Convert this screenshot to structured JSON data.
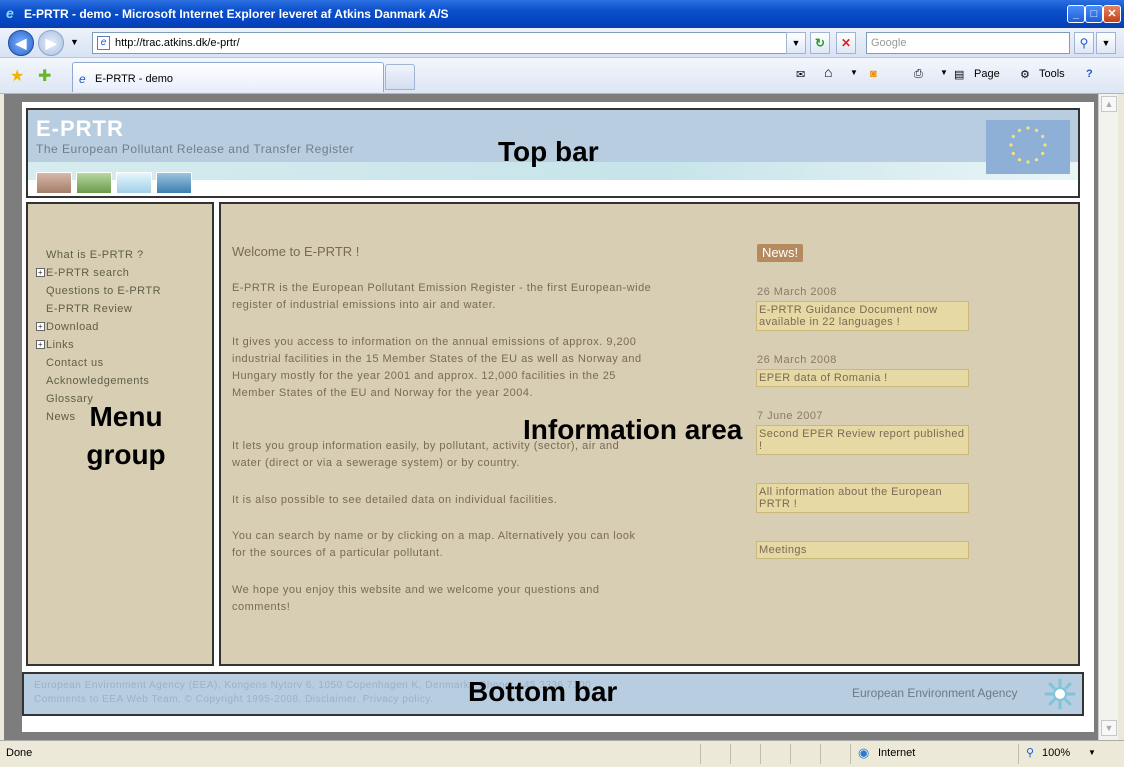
{
  "window": {
    "title": "E-PRTR - demo - Microsoft Internet Explorer leveret af Atkins Danmark A/S",
    "minimize": "_",
    "maximize": "□",
    "close": "✕"
  },
  "browser": {
    "address": "http://trac.atkins.dk/e-prtr/",
    "search_placeholder": "Google",
    "tab_title": "E-PRTR - demo",
    "tools": {
      "page_label": "Page",
      "tools_label": "Tools"
    }
  },
  "site": {
    "title": "E-PRTR",
    "subtitle": "The European Pollutant Release and Transfer Register"
  },
  "annotations": {
    "top_bar": "Top bar",
    "menu_group": "Menu group",
    "information_area": "Information area",
    "bottom_bar": "Bottom bar"
  },
  "menu": {
    "items": [
      {
        "label": "What is E-PRTR ?",
        "expandable": false
      },
      {
        "label": "E-PRTR search",
        "expandable": true
      },
      {
        "label": "Questions to E-PRTR",
        "expandable": false
      },
      {
        "label": "E-PRTR Review",
        "expandable": false
      },
      {
        "label": "Download",
        "expandable": true
      },
      {
        "label": "Links",
        "expandable": true
      },
      {
        "label": "Contact us",
        "expandable": false
      },
      {
        "label": "Acknowledgements",
        "expandable": false
      },
      {
        "label": "Glossary",
        "expandable": false
      },
      {
        "label": "News",
        "expandable": false
      }
    ]
  },
  "info": {
    "welcome": "Welcome to E-PRTR !",
    "paragraphs": [
      "E-PRTR is the European Pollutant Emission Register - the first European-wide register of industrial emissions into air and water.",
      "It gives you access to information on the annual emissions of approx. 9,200 industrial facilities in the 15 Member States of the EU as well as Norway and Hungary mostly for the year 2001 and approx. 12,000 facilities in the 25 Member States of the EU and Norway for the year 2004.",
      "It lets you group information easily, by pollutant, activity (sector), air and water (direct or via a sewerage system) or by country.",
      "It is also possible to see detailed data on individual facilities.",
      "You can search by name or by clicking on a map. Alternatively you can look for the sources of a particular pollutant.",
      "We hope you enjoy this website and we welcome your questions and comments!"
    ]
  },
  "news": {
    "badge": "News!",
    "items": [
      {
        "date": "26 March 2008",
        "text": "E-PRTR Guidance Document now available in 22 languages !"
      },
      {
        "date": "26 March 2008",
        "text": "EPER data of Romania !"
      },
      {
        "date": "7 June 2007",
        "text": "Second EPER Review report published !"
      },
      {
        "date": "",
        "text": "All information about the European PRTR !"
      },
      {
        "date": "",
        "text": "Meetings"
      }
    ]
  },
  "footer": {
    "line1": "European Environment Agency (EEA), Kongens Nytorv 6, 1050 Copenhagen K, Denmark - Phone: +45 3336 7100",
    "line2": "Comments to EEA Web Team. © Copyright 1995-2008. Disclaimer. Privacy policy.",
    "agency": "European Environment Agency"
  },
  "status": {
    "left": "Done",
    "zone": "Internet",
    "zoom": "100%"
  }
}
